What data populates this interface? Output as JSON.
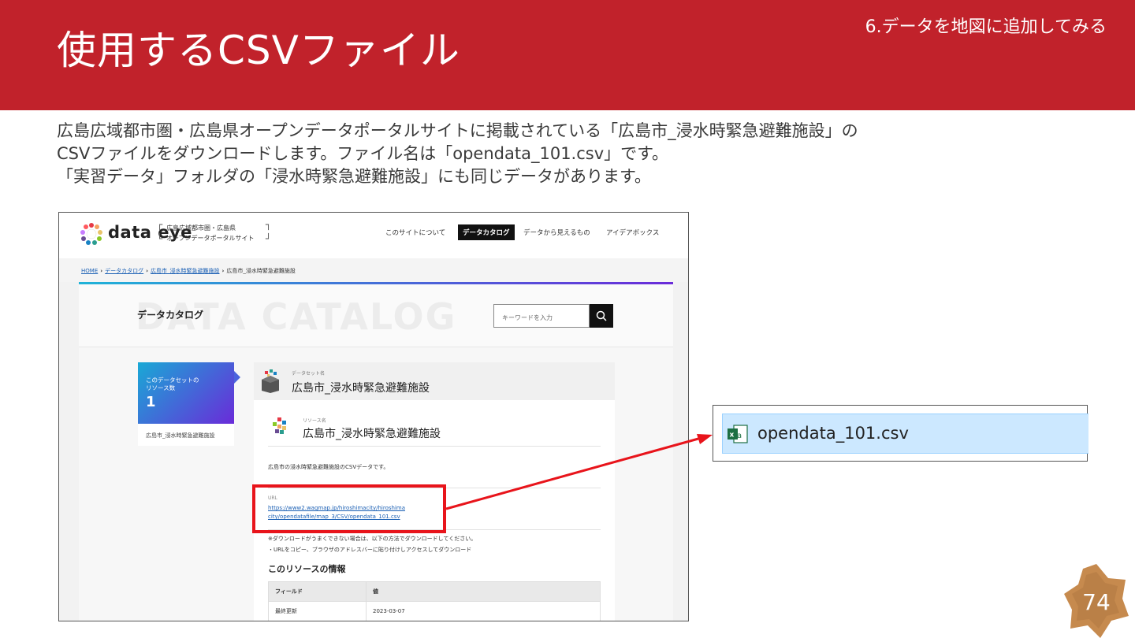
{
  "slide": {
    "title": "使用するCSVファイル",
    "section": "6.データを地図に追加してみる",
    "body_lines": [
      "広島広域都市圏・広島県オープンデータポータルサイトに掲載されている「広島市_浸水時緊急避難施設」の",
      "CSVファイルをダウンロードします。ファイル名は「opendata_101.csv」です。",
      "「実習データ」フォルダの「浸水時緊急避難施設」にも同じデータがあります。"
    ],
    "page_number": "74",
    "colors": {
      "header_red": "#c1222b",
      "highlight_red": "#e8141b",
      "file_selected": "#cce8ff"
    }
  },
  "site": {
    "logo_text": "data eye",
    "portal_name_line1": "広島広域都市圏・広島県",
    "portal_name_line2": "オープンデータポータルサイト",
    "nav": [
      "このサイトについて",
      "データカタログ",
      "データから見えるもの",
      "アイデアボックス"
    ],
    "breadcrumb": [
      "HOME",
      "データカタログ",
      "広島市_浸水時緊急避難施設",
      "広島市_浸水時緊急避難施設"
    ],
    "catalog_bg_word": "DATA CATALOG",
    "catalog_title": "データカタログ",
    "search_placeholder": "キーワードを入力",
    "resource_count_label_1": "このデータセットの",
    "resource_count_label_2": "リソース数",
    "resource_count": "1",
    "side_resource_link": "広島市_浸水時緊急避難施設",
    "dataset_label": "データセット名",
    "dataset_name": "広島市_浸水時緊急避難施設",
    "resource_label": "リソース名",
    "resource_name": "広島市_浸水時緊急避難施設",
    "resource_description": "広島市の浸水時緊急避難施設のCSVデータです。",
    "url_label": "URL",
    "url_line1": "https://www2.wagmap.jp/hiroshimacity/hiroshima",
    "url_line2": "city/opendatafile/map_3/CSV/opendata_101.csv",
    "note1": "※ダウンロードがうまくできない場合は、以下の方法でダウンロードしてください。",
    "note2": "・URLをコピー、ブラウザのアドレスバーに貼り付けしアクセスしてダウンロード",
    "info_title": "このリソースの情報",
    "table_headers": [
      "フィールド",
      "値"
    ],
    "table_rows": [
      [
        "最終更新",
        "2023-03-07"
      ]
    ]
  },
  "file": {
    "name": "opendata_101.csv",
    "icon": "excel-csv-icon"
  }
}
